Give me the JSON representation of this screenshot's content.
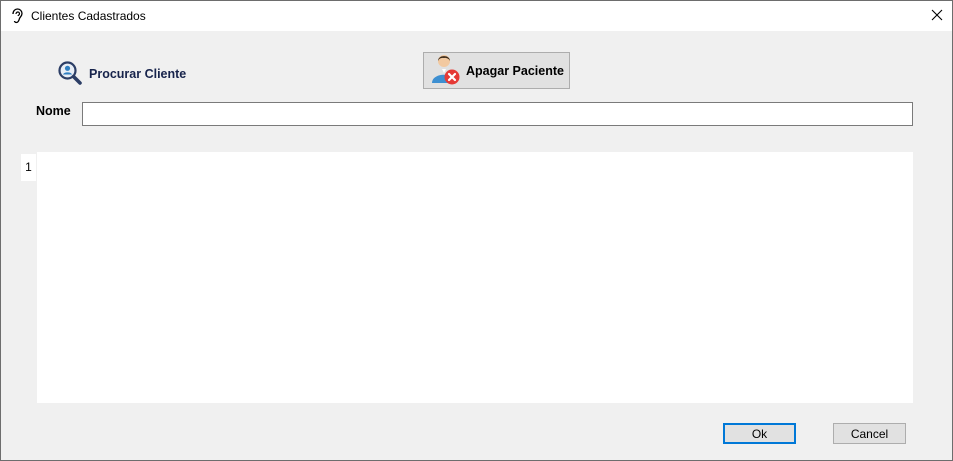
{
  "window": {
    "title": "Clientes Cadastrados"
  },
  "toolbar": {
    "search_label": "Procurar Cliente",
    "delete_label": "Apagar Paciente"
  },
  "form": {
    "name_label": "Nome",
    "name_value": ""
  },
  "grid": {
    "row_numbers": [
      "1"
    ]
  },
  "footer": {
    "ok_label": "Ok",
    "cancel_label": "Cancel"
  },
  "colors": {
    "accent": "#0078d7",
    "search_text": "#17234b",
    "delete_badge": "#e53935"
  },
  "icons": {
    "app": "ear-icon",
    "close": "close-icon",
    "search": "search-user-icon",
    "delete": "user-delete-icon"
  }
}
